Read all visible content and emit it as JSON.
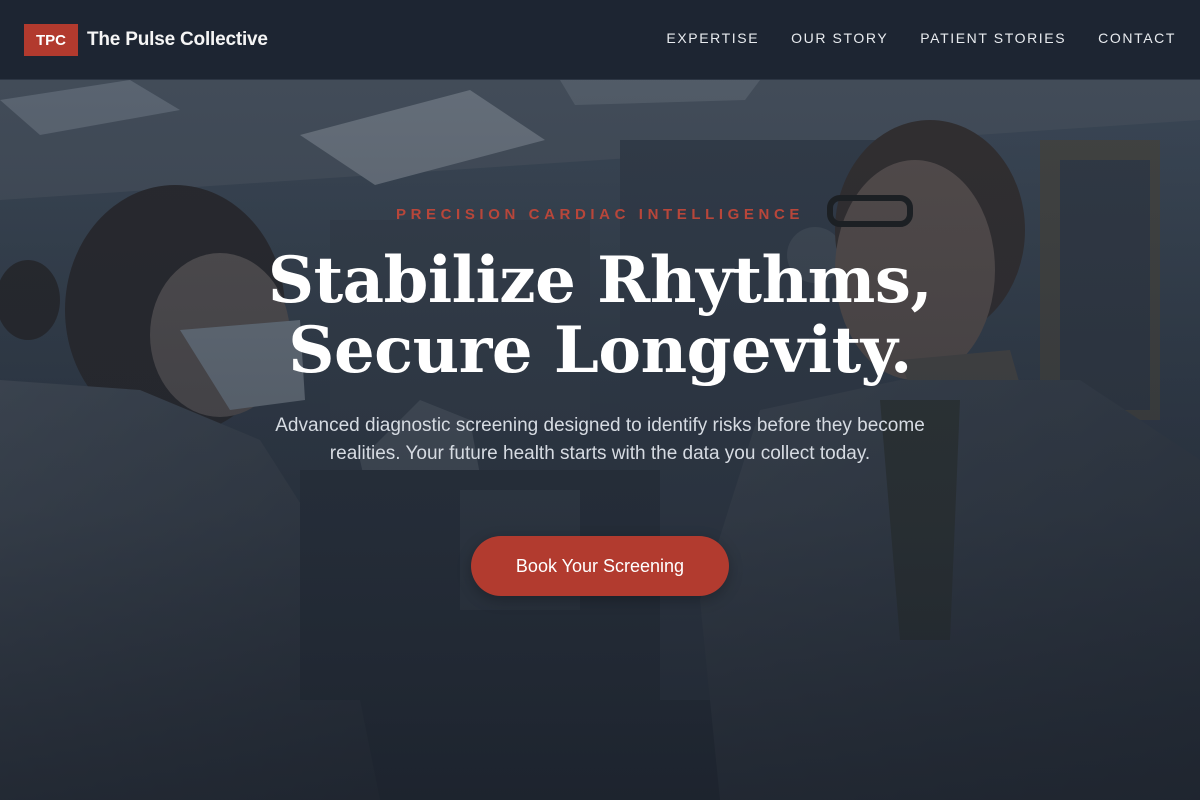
{
  "header": {
    "logo_text": "TPC",
    "brand_name": "The Pulse Collective",
    "nav": [
      {
        "label": "EXPERTISE"
      },
      {
        "label": "OUR STORY"
      },
      {
        "label": "PATIENT STORIES"
      },
      {
        "label": "CONTACT"
      }
    ]
  },
  "hero": {
    "eyebrow": "PRECISION CARDIAC INTELLIGENCE",
    "headline_line1": "Stabilize Rhythms,",
    "headline_line2": "Secure Longevity.",
    "subtext": "Advanced diagnostic screening designed to identify risks before they become realities. Your future health starts with the data you collect today.",
    "cta_label": "Book Your Screening",
    "background_image": "lab-clinicians-photo"
  },
  "colors": {
    "accent": "#b23b2f",
    "header_bg": "#1d2532",
    "text_light": "#ffffff"
  }
}
